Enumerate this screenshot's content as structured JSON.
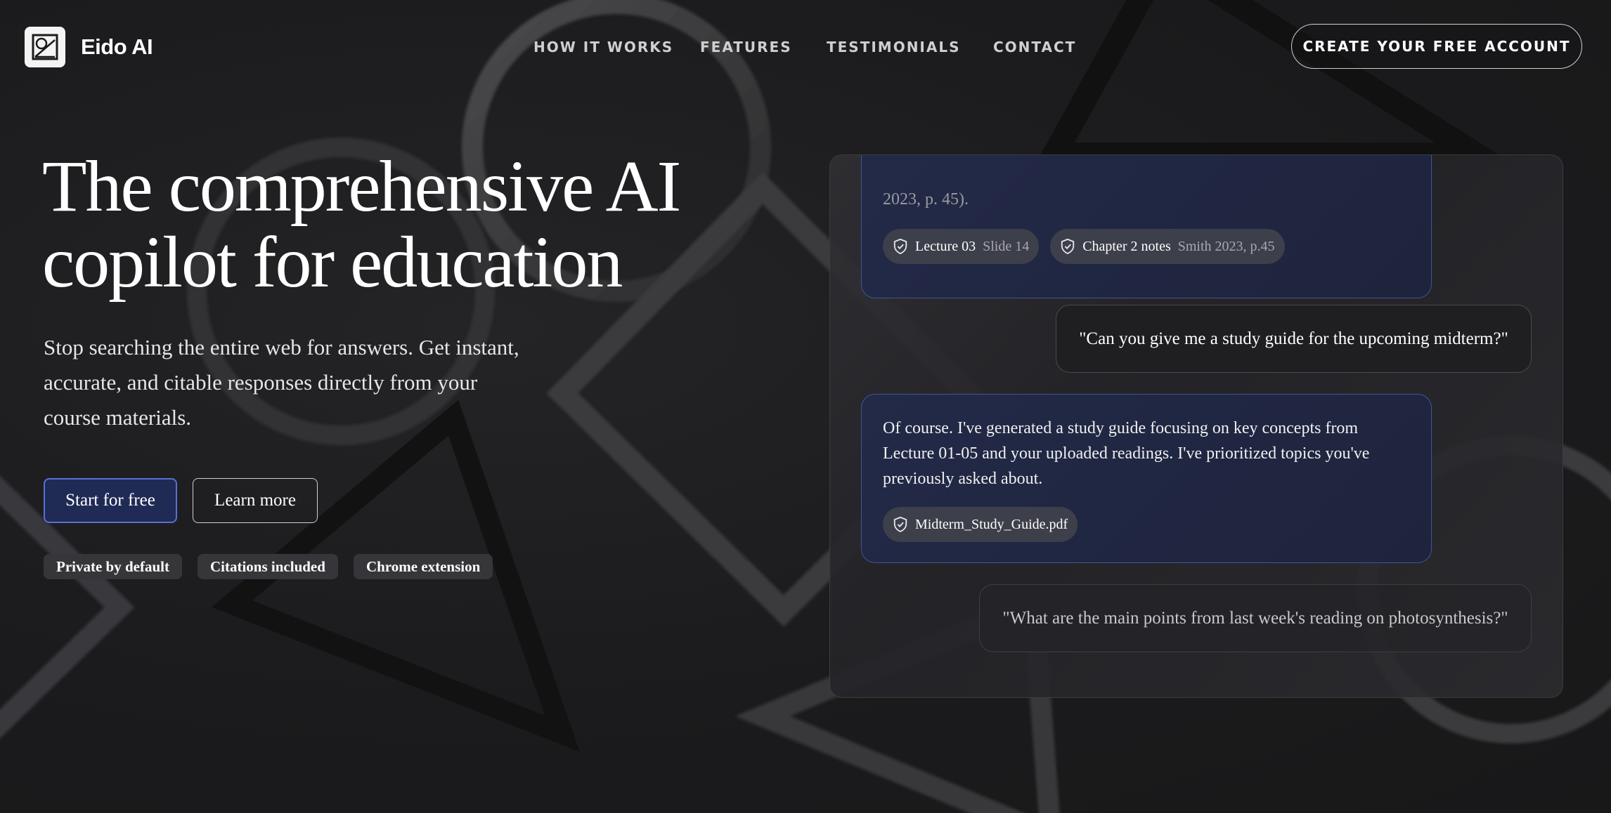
{
  "brand": {
    "name": "Eido AI",
    "logo_icon": "framed-diagonal-logo-icon"
  },
  "nav": {
    "links": [
      "HOW IT WORKS",
      "FEATURES",
      "TESTIMONIALS",
      "CONTACT"
    ],
    "cta_label": "CREATE YOUR FREE ACCOUNT"
  },
  "hero": {
    "title_line1": "The comprehensive AI",
    "title_line2": "copilot for education",
    "subtitle_line1": "Stop searching the entire web for answers. Get instant,",
    "subtitle_line2": "accurate, and citable responses directly from your",
    "subtitle_line3": "course materials.",
    "primary_button": "Start for free",
    "secondary_button": "Learn more",
    "tags": [
      "Private by default",
      "Citations included",
      "Chrome extension"
    ]
  },
  "chat": {
    "message1": {
      "text_tail": "2023, p. 45).",
      "citations": [
        {
          "label": "Lecture 03",
          "detail": "Slide 14",
          "icon": "shield-check-icon"
        },
        {
          "label": "Chapter 2 notes",
          "detail": "Smith 2023, p.45",
          "icon": "shield-check-icon"
        }
      ]
    },
    "message2": {
      "text": "\"Can you give me a study guide for the upcoming midterm?\""
    },
    "message3": {
      "text_line1": "Of course. I've generated a study guide focusing on key concepts from",
      "text_line2": "Lecture 01-05 and your uploaded readings. I've prioritized topics you've",
      "text_line3": "previously asked about.",
      "attachment": {
        "label": "Midterm_Study_Guide.pdf",
        "icon": "shield-check-icon"
      }
    },
    "message4": {
      "text": "\"What are the main points from last week's reading on photosynthesis?\""
    }
  },
  "colors": {
    "background": "#1b1b1d",
    "primary_button_bg": "#1f2a55",
    "primary_button_border": "#5a6fd6",
    "ai_bubble_border": "#3f5594",
    "tag_bg": "#36363a"
  }
}
